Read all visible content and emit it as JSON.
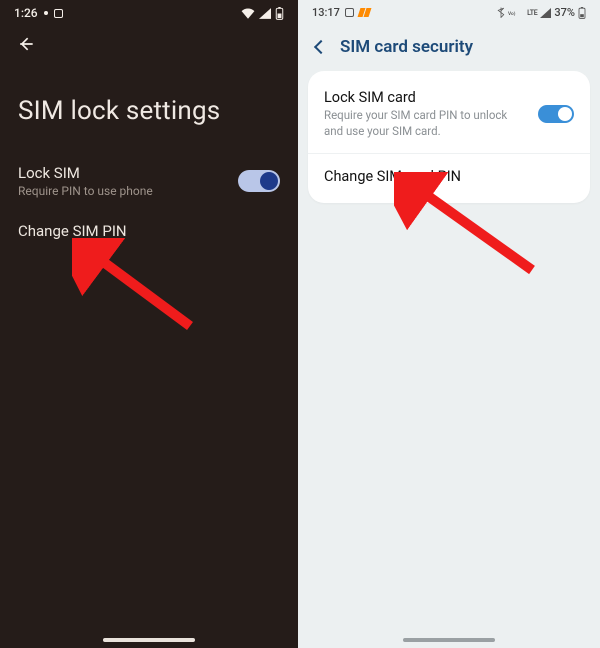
{
  "left": {
    "status": {
      "time": "1:26",
      "battery_icon": "battery",
      "wifi_icon": "wifi"
    },
    "page_title": "SIM lock settings",
    "lock_row": {
      "title": "Lock SIM",
      "subtitle": "Require PIN to use phone",
      "toggle_on": true
    },
    "change_row": {
      "title": "Change SIM PIN"
    }
  },
  "right": {
    "status": {
      "time": "13:17",
      "battery_pct": "37%",
      "net": "LTE"
    },
    "header": {
      "title": "SIM card security"
    },
    "lock_row": {
      "title": "Lock SIM card",
      "subtitle": "Require your SIM card PIN to unlock and use your SIM card.",
      "toggle_on": true
    },
    "change_row": {
      "title": "Change SIM card PIN"
    }
  },
  "annotation": {
    "color": "#ef1c1c"
  }
}
